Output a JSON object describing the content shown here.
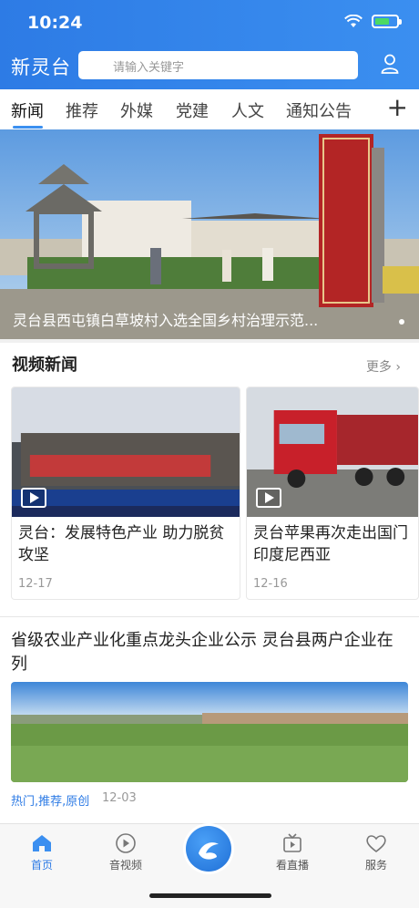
{
  "status_bar": {
    "time": "10:24",
    "battery_level": 0.7,
    "battery_color": "#4cd964"
  },
  "header": {
    "logo": "新灵台",
    "search_placeholder": "请输入关键字",
    "user_icon": "user-icon",
    "accent": "#3b8ff0"
  },
  "tabs": {
    "items": [
      "新闻",
      "推荐",
      "外媒",
      "党建",
      "人文",
      "通知公告"
    ],
    "active_index": 0,
    "add_icon": "plus-icon"
  },
  "banner": {
    "caption": "灵台县西屯镇白草坡村入选全国乡村治理示范..."
  },
  "video_news": {
    "title": "视频新闻",
    "more_label": "更多",
    "cards": [
      {
        "title": "灵台：发展特色产业 助力脱贫攻坚",
        "date": "12-17"
      },
      {
        "title": "灵台苹果再次走出国门 印度尼西亚",
        "date": "12-16"
      }
    ]
  },
  "article": {
    "title": "省级农业产业化重点龙头企业公示  灵台县两户企业在列",
    "tags": "热门,推荐,原创",
    "date": "12-03"
  },
  "bottom_nav": {
    "items": [
      {
        "label": "首页",
        "icon": "home-icon",
        "active": true
      },
      {
        "label": "音视频",
        "icon": "play-circle-icon",
        "active": false
      },
      {
        "label": "看直播",
        "icon": "tv-icon",
        "active": false
      },
      {
        "label": "服务",
        "icon": "heart-icon",
        "active": false
      }
    ],
    "center_icon": "app-logo-icon"
  }
}
